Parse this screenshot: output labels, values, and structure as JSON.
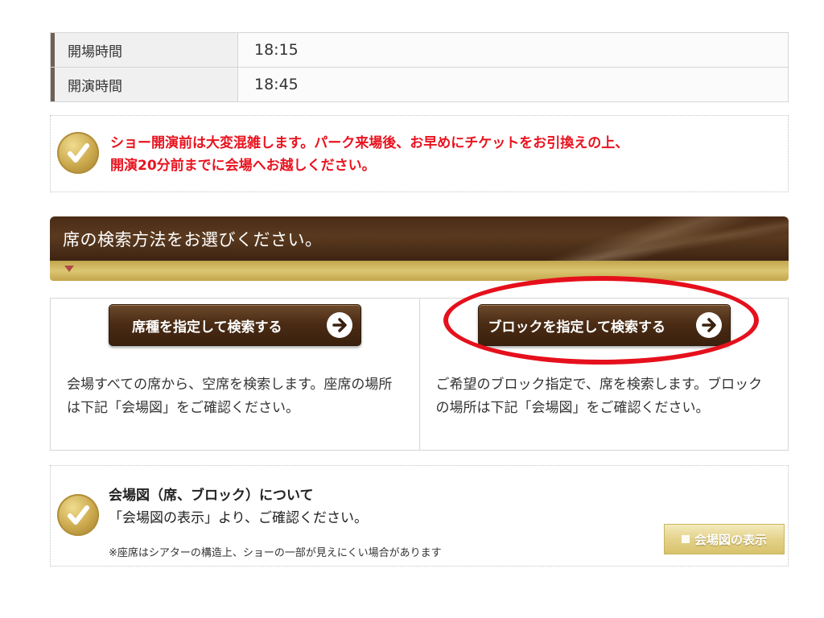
{
  "schedule": {
    "rows": [
      {
        "label": "開場時間",
        "value": "18:15"
      },
      {
        "label": "開演時間",
        "value": "18:45"
      }
    ]
  },
  "notice": {
    "icon": "check-icon",
    "line1": "ショー開演前は大変混雑します。パーク来場後、お早めにチケットをお引換えの上、",
    "line2": "開演20分前までに会場へお越しください。",
    "color": "#e8131f"
  },
  "section": {
    "title": "席の検索方法をお選びください。",
    "marker_icon": "triangle-down-icon"
  },
  "search": {
    "seat_type": {
      "button_label": "席種を指定して検索する",
      "icon": "arrow-right-icon",
      "description": "会場すべての席から、空席を検索します。座席の場所は下記「会場図」をご確認ください。"
    },
    "block": {
      "button_label": "ブロックを指定して検索する",
      "icon": "arrow-right-icon",
      "description": "ご希望のブロック指定で、席を検索します。ブロックの場所は下記「会場図」をご確認ください。",
      "highlighted": true,
      "highlight_color": "#e5101c"
    }
  },
  "venue_map": {
    "icon": "check-icon",
    "title": "会場図（席、ブロック）について",
    "subtitle": "「会場図の表示」より、ご確認ください。",
    "note": "※座席はシアターの構造上、ショーの一部が見えにくい場合があります",
    "button_label": "会場図の表示"
  },
  "colors": {
    "header_brown": "#4a2b15",
    "header_gold": "#c9ad55",
    "button_brown": "#4b2c15"
  }
}
